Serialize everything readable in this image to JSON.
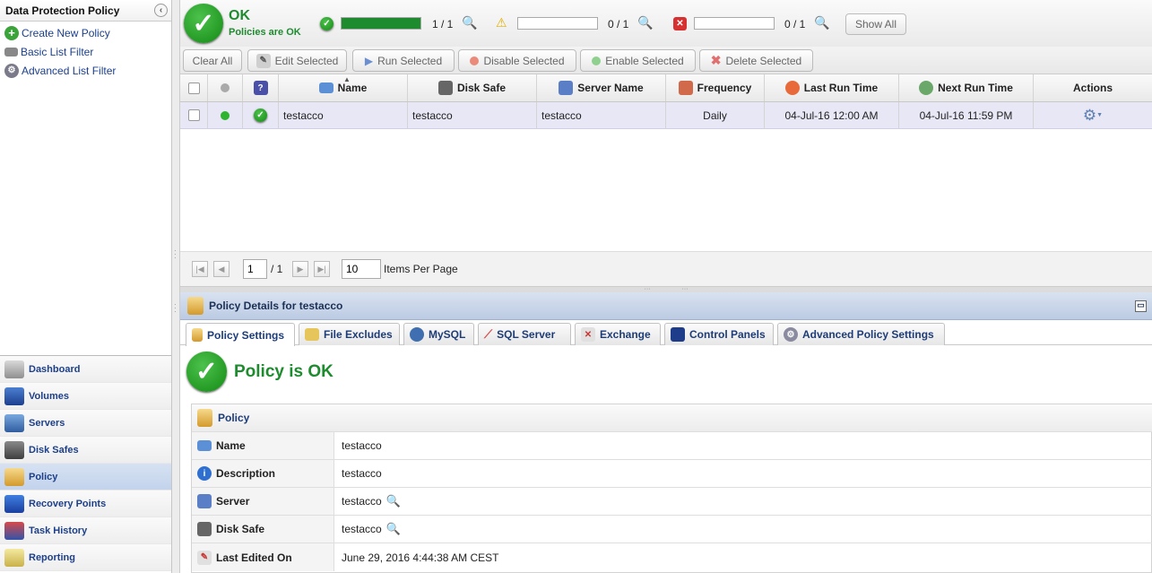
{
  "left": {
    "title": "Data Protection Policy",
    "links": [
      {
        "label": "Create New Policy",
        "icon": "plus-icon"
      },
      {
        "label": "Basic List Filter",
        "icon": "filter-icon"
      },
      {
        "label": "Advanced List Filter",
        "icon": "advanced-filter-icon"
      }
    ],
    "nav": [
      {
        "label": "Dashboard",
        "icon": "dashboard-icon",
        "active": false
      },
      {
        "label": "Volumes",
        "icon": "volume-icon",
        "active": false
      },
      {
        "label": "Servers",
        "icon": "server-icon",
        "active": false
      },
      {
        "label": "Disk Safes",
        "icon": "disk-safe-icon",
        "active": false
      },
      {
        "label": "Policy",
        "icon": "policy-icon",
        "active": true
      },
      {
        "label": "Recovery Points",
        "icon": "recovery-points-icon",
        "active": false
      },
      {
        "label": "Task History",
        "icon": "task-history-icon",
        "active": false
      },
      {
        "label": "Reporting",
        "icon": "reporting-icon",
        "active": false
      }
    ]
  },
  "status": {
    "title": "OK",
    "subtitle": "Policies are OK",
    "ok": {
      "count": "1 / 1",
      "fraction": 1.0
    },
    "warning": {
      "count": "0 / 1",
      "fraction": 0.0
    },
    "error": {
      "count": "0 / 1",
      "fraction": 0.0
    },
    "show_all": "Show All"
  },
  "toolbar": {
    "clear_all": "Clear All",
    "edit": "Edit Selected",
    "run": "Run Selected",
    "disable": "Disable Selected",
    "enable": "Enable Selected",
    "delete": "Delete Selected"
  },
  "grid": {
    "headers": {
      "name": "Name",
      "disk_safe": "Disk Safe",
      "server_name": "Server Name",
      "frequency": "Frequency",
      "last_run": "Last Run Time",
      "next_run": "Next Run Time",
      "actions": "Actions"
    },
    "rows": [
      {
        "name": "testacco",
        "disk_safe": "testacco",
        "server_name": "testacco",
        "frequency": "Daily",
        "last_run": "04-Jul-16 12:00 AM",
        "next_run": "04-Jul-16 11:59 PM"
      }
    ]
  },
  "pager": {
    "page": "1",
    "of": "/ 1",
    "per_page": "10",
    "per_page_label": "Items Per Page"
  },
  "details": {
    "header": "Policy Details for testacco",
    "tabs": [
      "Policy Settings",
      "File Excludes",
      "MySQL",
      "SQL Server",
      "Exchange",
      "Control Panels",
      "Advanced Policy Settings"
    ],
    "status_text": "Policy is OK",
    "section": "Policy",
    "rows": [
      {
        "key": "Name",
        "value": "testacco"
      },
      {
        "key": "Description",
        "value": "testacco"
      },
      {
        "key": "Server",
        "value": "testacco"
      },
      {
        "key": "Disk Safe",
        "value": "testacco"
      },
      {
        "key": "Last Edited On",
        "value": "June 29, 2016 4:44:38 AM CEST"
      }
    ]
  },
  "colors": {
    "ok": "#1d8b2e",
    "link": "#1b3f8b",
    "selected_row": "#e7e7f6"
  }
}
